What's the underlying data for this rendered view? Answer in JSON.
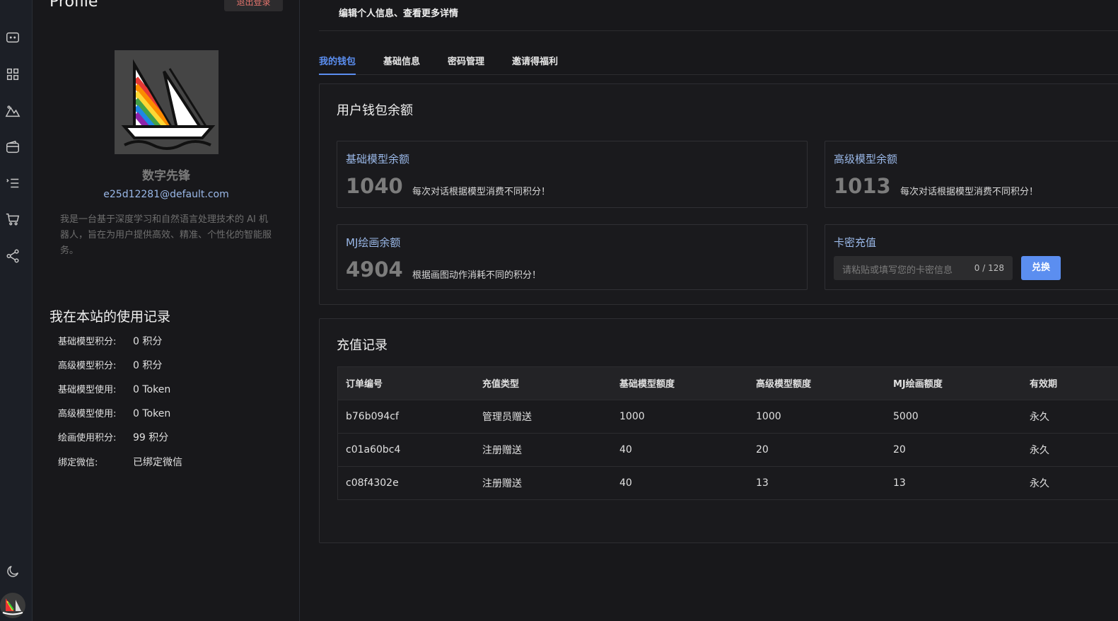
{
  "sidebar_icons": [
    "chat-icon",
    "apps-grid-icon",
    "mountain-image-icon",
    "wallet-icon",
    "list-icon",
    "cart-icon",
    "share-icon",
    "moon-icon"
  ],
  "profile": {
    "title": "Profile",
    "logout_label": "退出登录",
    "username": "数字先锋",
    "email": "e25d12281@default.com",
    "bio": "我是一台基于深度学习和自然语言处理技术的 AI 机器人，旨在为用户提供高效、精准、个性化的智能服务。"
  },
  "usage": {
    "title": "我在本站的使用记录",
    "rows": [
      {
        "label": "基础模型积分:",
        "value": "0 积分"
      },
      {
        "label": "高级模型积分:",
        "value": "0 积分"
      },
      {
        "label": "基础模型使用:",
        "value": "0 Token"
      },
      {
        "label": "高级模型使用:",
        "value": "0 Token"
      },
      {
        "label": "绘画使用积分:",
        "value": "99 积分"
      },
      {
        "label": "绑定微信:",
        "value": "已绑定微信"
      }
    ]
  },
  "header": {
    "description": "编辑个人信息、查看更多详情"
  },
  "tabs": [
    {
      "label": "我的钱包",
      "active": true
    },
    {
      "label": "基础信息",
      "active": false
    },
    {
      "label": "密码管理",
      "active": false
    },
    {
      "label": "邀请得福利",
      "active": false
    }
  ],
  "wallet": {
    "title": "用户钱包余额",
    "basic": {
      "title": "基础模型余额",
      "value": "1040",
      "note": "每次对话根据模型消费不同积分！"
    },
    "advanced": {
      "title": "高级模型余额",
      "value": "1013",
      "note": "每次对话根据模型消费不同积分！"
    },
    "mj": {
      "title": "MJ绘画余额",
      "value": "4904",
      "note": "根据画图动作消耗不同的积分！"
    },
    "card": {
      "title": "卡密充值",
      "placeholder": "请粘贴或填写您的卡密信息",
      "counter": "0 / 128",
      "button": "兑换"
    }
  },
  "recharge": {
    "title": "充值记录",
    "columns": [
      "订单编号",
      "充值类型",
      "基础模型额度",
      "高级模型额度",
      "MJ绘画额度",
      "有效期"
    ],
    "rows": [
      [
        "b76b094cf",
        "管理员赠送",
        "1000",
        "1000",
        "5000",
        "永久"
      ],
      [
        "c01a60bc4",
        "注册赠送",
        "40",
        "20",
        "20",
        "永久"
      ],
      [
        "c08f4302e",
        "注册赠送",
        "40",
        "13",
        "13",
        "永久"
      ]
    ]
  },
  "colors": {
    "accent": "#5b8ef0",
    "background": "#18181b",
    "danger": "#e5756d"
  }
}
